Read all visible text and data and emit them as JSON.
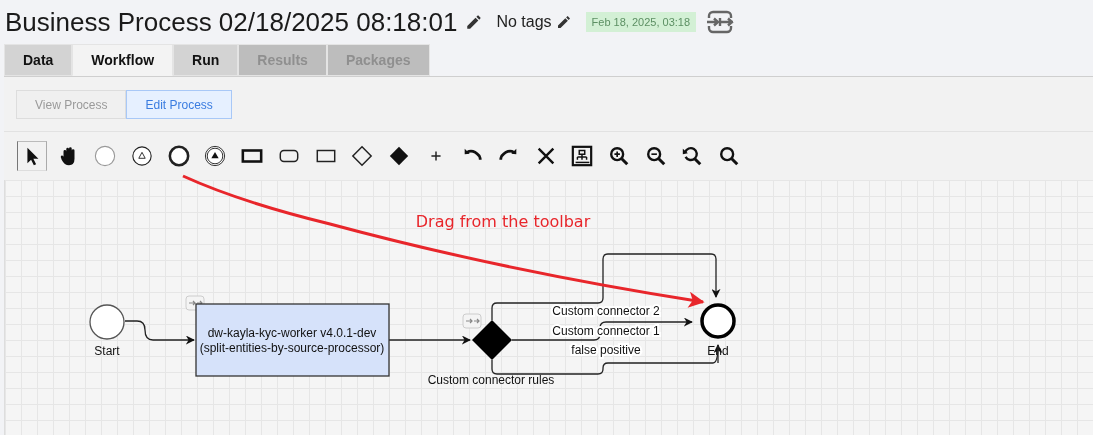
{
  "header": {
    "title": "Business Process 02/18/2025 08:18:01",
    "tags": "No tags",
    "date_badge": "Feb 18, 2025, 03:18"
  },
  "tabs": [
    {
      "label": "Data",
      "selected": false,
      "disabled": false
    },
    {
      "label": "Workflow",
      "selected": true,
      "disabled": false
    },
    {
      "label": "Run",
      "selected": false,
      "disabled": false
    },
    {
      "label": "Results",
      "selected": false,
      "disabled": true
    },
    {
      "label": "Packages",
      "selected": false,
      "disabled": true
    }
  ],
  "modes": [
    {
      "label": "View Process",
      "selected": false
    },
    {
      "label": "Edit Process",
      "selected": true
    }
  ],
  "toolbar": [
    {
      "kind": "pointer",
      "selected": true
    },
    {
      "kind": "hand",
      "selected": false
    },
    {
      "kind": "start",
      "selected": false
    },
    {
      "kind": "message",
      "selected": false
    },
    {
      "kind": "end",
      "selected": false
    },
    {
      "kind": "signal",
      "selected": false
    },
    {
      "kind": "task",
      "selected": false
    },
    {
      "kind": "subprocess",
      "selected": false
    },
    {
      "kind": "box",
      "selected": false
    },
    {
      "kind": "diamond",
      "selected": false
    },
    {
      "kind": "gateway",
      "selected": false
    },
    {
      "kind": "plus",
      "selected": false
    },
    {
      "kind": "undo",
      "selected": false
    },
    {
      "kind": "redo",
      "selected": false
    },
    {
      "kind": "delete",
      "selected": false
    },
    {
      "kind": "layout",
      "selected": false
    },
    {
      "kind": "zoom-in",
      "selected": false
    },
    {
      "kind": "zoom-out",
      "selected": false
    },
    {
      "kind": "zoom-reset",
      "selected": false
    },
    {
      "kind": "zoom",
      "selected": false
    }
  ],
  "diagram": {
    "annotation": "Drag from the toolbar",
    "nodes": [
      {
        "kind": "start",
        "label": "Start"
      },
      {
        "kind": "task",
        "lines": [
          "dw-kayla-kyc-worker v4.0.1-dev",
          "(split-entities-by-source-processor)"
        ]
      },
      {
        "kind": "gateway",
        "label": "Custom connector rules"
      },
      {
        "kind": "end",
        "label": "End"
      }
    ],
    "connectors": [
      {
        "label": "Custom connector 2"
      },
      {
        "label": "Custom connector 1"
      },
      {
        "label": "false positive"
      }
    ]
  }
}
